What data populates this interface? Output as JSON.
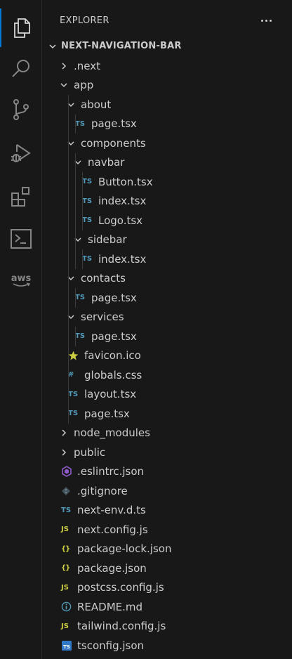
{
  "activity_bar": {
    "items": [
      {
        "name": "explorer-icon"
      },
      {
        "name": "search-icon"
      },
      {
        "name": "source-control-icon"
      },
      {
        "name": "run-debug-icon"
      },
      {
        "name": "extensions-icon"
      },
      {
        "name": "terminal-icon"
      },
      {
        "name": "aws-icon",
        "label": "aws"
      }
    ],
    "accent_color": "#0078d4"
  },
  "explorer": {
    "title": "EXPLORER",
    "more_actions": "...",
    "root": "NEXT-NAVIGATION-BAR",
    "tree": [
      {
        "label": ".next",
        "type": "folder",
        "expanded": false,
        "depth": 1
      },
      {
        "label": "app",
        "type": "folder",
        "expanded": true,
        "depth": 1
      },
      {
        "label": "about",
        "type": "folder",
        "expanded": true,
        "depth": 2
      },
      {
        "label": "page.tsx",
        "type": "ts",
        "depth": 3
      },
      {
        "label": "components",
        "type": "folder",
        "expanded": true,
        "depth": 2
      },
      {
        "label": "navbar",
        "type": "folder",
        "expanded": true,
        "depth": 3
      },
      {
        "label": "Button.tsx",
        "type": "ts",
        "depth": 4
      },
      {
        "label": "index.tsx",
        "type": "ts",
        "depth": 4
      },
      {
        "label": "Logo.tsx",
        "type": "ts",
        "depth": 4
      },
      {
        "label": "sidebar",
        "type": "folder",
        "expanded": true,
        "depth": 3
      },
      {
        "label": "index.tsx",
        "type": "ts",
        "depth": 4
      },
      {
        "label": "contacts",
        "type": "folder",
        "expanded": true,
        "depth": 2
      },
      {
        "label": "page.tsx",
        "type": "ts",
        "depth": 3
      },
      {
        "label": "services",
        "type": "folder",
        "expanded": true,
        "depth": 2
      },
      {
        "label": "page.tsx",
        "type": "ts",
        "depth": 3
      },
      {
        "label": "favicon.ico",
        "type": "ico",
        "depth": 2
      },
      {
        "label": "globals.css",
        "type": "css",
        "depth": 2
      },
      {
        "label": "layout.tsx",
        "type": "ts",
        "depth": 2
      },
      {
        "label": "page.tsx",
        "type": "ts",
        "depth": 2
      },
      {
        "label": "node_modules",
        "type": "folder",
        "expanded": false,
        "depth": 1
      },
      {
        "label": "public",
        "type": "folder",
        "expanded": false,
        "depth": 1
      },
      {
        "label": ".eslintrc.json",
        "type": "eslint",
        "depth": 1
      },
      {
        "label": ".gitignore",
        "type": "git",
        "depth": 1
      },
      {
        "label": "next-env.d.ts",
        "type": "ts",
        "depth": 1
      },
      {
        "label": "next.config.js",
        "type": "js",
        "depth": 1
      },
      {
        "label": "package-lock.json",
        "type": "json",
        "depth": 1
      },
      {
        "label": "package.json",
        "type": "json",
        "depth": 1
      },
      {
        "label": "postcss.config.js",
        "type": "js",
        "depth": 1
      },
      {
        "label": "README.md",
        "type": "info",
        "depth": 1
      },
      {
        "label": "tailwind.config.js",
        "type": "js",
        "depth": 1
      },
      {
        "label": "tsconfig.json",
        "type": "tsconfig",
        "depth": 1
      }
    ],
    "icon_glyphs": {
      "ts": "TS",
      "js": "JS",
      "json": "{}",
      "css": "#"
    },
    "colors": {
      "ts": "#519aba",
      "js": "#cbcb41",
      "eslint": "#8e59c9",
      "git": "#6d8086"
    }
  }
}
